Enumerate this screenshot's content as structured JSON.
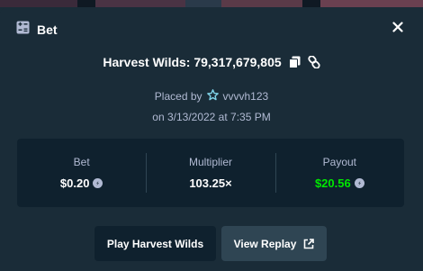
{
  "modal": {
    "title": "Bet",
    "icon": "bet-slip-icon",
    "close_icon": "close-icon"
  },
  "game": {
    "line": "Harvest Wilds: 79,317,679,805",
    "copy_icon": "copy-icon",
    "link_icon": "link-icon"
  },
  "placed": {
    "prefix": "Placed by",
    "username": "vvvvh123",
    "user_icon": "vip-star-icon",
    "date": "on 3/13/2022 at 7:35 PM"
  },
  "stats": {
    "bet": {
      "label": "Bet",
      "value": "$0.20",
      "currency_icon": "coin-icon"
    },
    "multiplier": {
      "label": "Multiplier",
      "value": "103.25×"
    },
    "payout": {
      "label": "Payout",
      "value": "$20.56",
      "currency_icon": "coin-icon",
      "color": "#00e701"
    }
  },
  "actions": {
    "play_label": "Play Harvest Wilds",
    "replay_label": "View Replay",
    "replay_icon": "external-link-icon"
  },
  "colors": {
    "background": "#1a2c38",
    "panel": "#0f212e",
    "muted_text": "#b1bad3",
    "secondary_button": "#2f4553",
    "green": "#00e701"
  }
}
